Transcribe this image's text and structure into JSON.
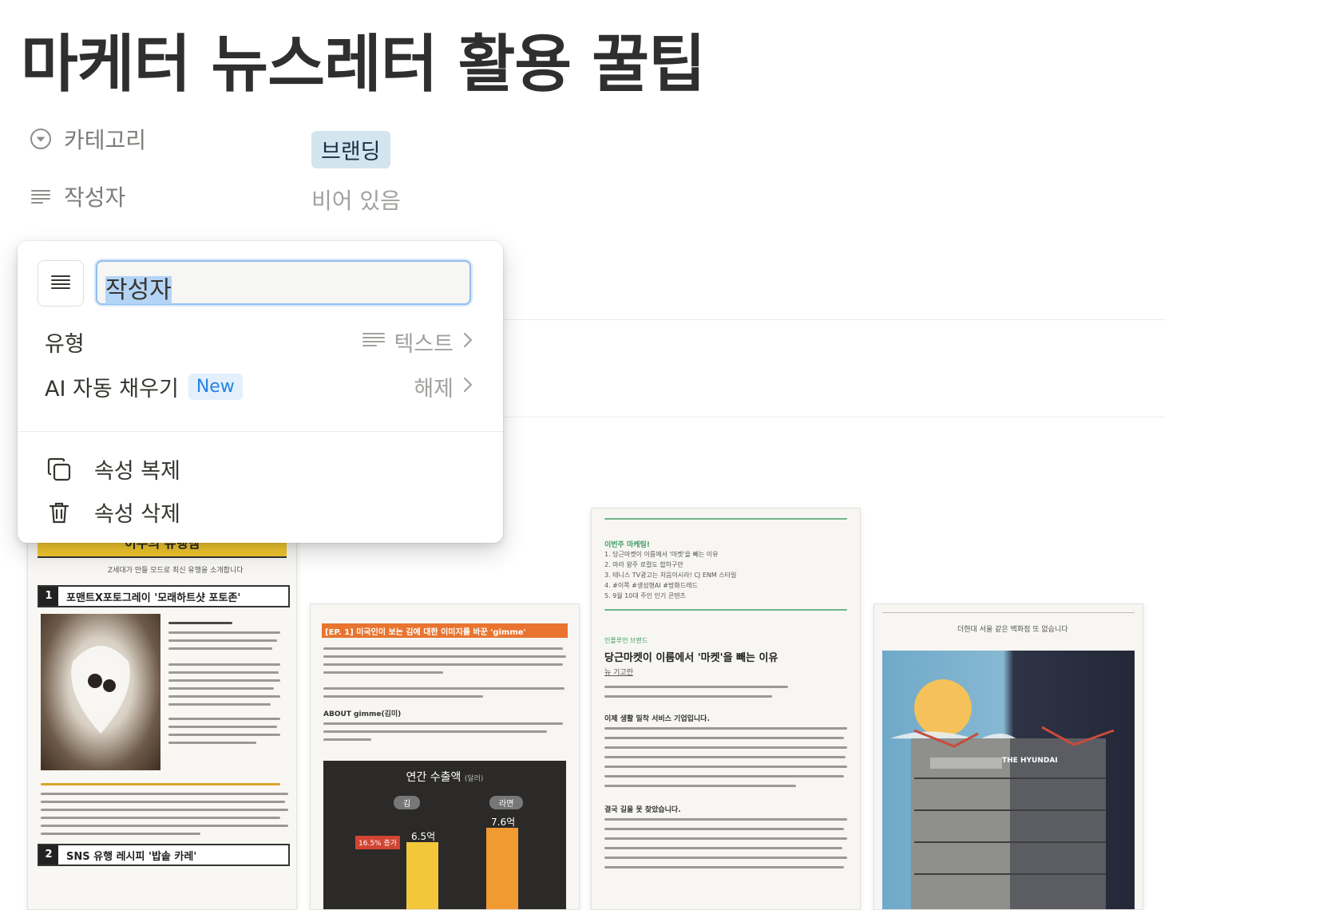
{
  "page": {
    "title": "마케터 뉴스레터 활용 꿀팁"
  },
  "properties": [
    {
      "icon": "select-icon",
      "label": "카테고리",
      "value": "브랜딩"
    },
    {
      "icon": "text-lines-icon",
      "label": "작성자",
      "value": "비어 있음"
    }
  ],
  "popup": {
    "name_value": "작성자",
    "type_label": "유형",
    "type_value": "텍스트",
    "ai_label": "AI 자동 채우기",
    "ai_badge": "New",
    "ai_value": "해제",
    "duplicate_label": "속성 복제",
    "delete_label": "속성 삭제"
  },
  "gallery": {
    "card1": {
      "banner": "이주의 유행템",
      "subtitle": "Z세대가 만들 모드로 최신 유행을 소개합니다",
      "item1_num": "1",
      "item1_title": "포맨트X포토그레이 '모래하트샷 포토존'",
      "item2_num": "2",
      "item2_title": "SNS 유행 레시피 '밥솥 카레'"
    },
    "card2": {
      "header": "[EP. 1] 미국인이 보는 김에 대한 이미지를 바꾼 'gimme'",
      "about": "ABOUT gimme(김미)",
      "chart_title": "연간 수출액",
      "chart_unit": "(달러)",
      "bar1_label": "김",
      "bar2_label": "라면",
      "bar1_value": "6.5억",
      "bar2_value": "7.6억",
      "note": "16.5% 증가"
    },
    "card3": {
      "section": "이번주 마케팅!",
      "list": [
        "1. 당근마켓이 이름에서 '마켓'을 빼는 이유",
        "2. 마라 왕주 로컬도 합하구만",
        "3. 테니스 TV광고는 처음이시라! CJ ENM 스타일",
        "4. #이쪽 #생성형AI #방화드레드",
        "5. 9월 10대 주인 인기 콘텐츠"
      ],
      "tag": "인플루언 브랜드",
      "headline": "당근마켓이 이름에서 '마켓'을 빼는 이유",
      "link": "뉴 기고란",
      "subhead1": "이제 생활 밀착 서비스 기업입니다.",
      "subhead2": "결국 길을 못 찾았습니다."
    },
    "card4": {
      "caption": "더현대 서울 같은 백화점 또 없습니다",
      "sign": "THE HYUNDAI"
    }
  },
  "colors": {
    "tag_bg": "#d3e5ef",
    "accent_blue": "#2383e2",
    "banner_yellow": "#f2c72e",
    "card2_orange": "#e8742f"
  }
}
